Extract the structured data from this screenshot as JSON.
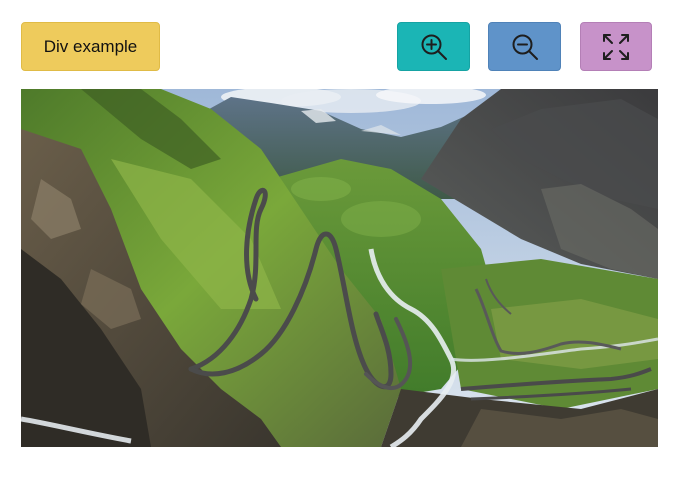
{
  "toolbar": {
    "div_example_label": "Div example",
    "zoom_in_icon": "zoom-in-icon",
    "zoom_out_icon": "zoom-out-icon",
    "fullscreen_icon": "fullscreen-expand-icon"
  },
  "colors": {
    "div_example_bg": "#eecb5c",
    "zoom_in_bg": "#1bb5b5",
    "zoom_out_bg": "#5f93c9",
    "fullscreen_bg": "#c792c9"
  },
  "image": {
    "subject": "mountain-valley-serpentine-road"
  }
}
